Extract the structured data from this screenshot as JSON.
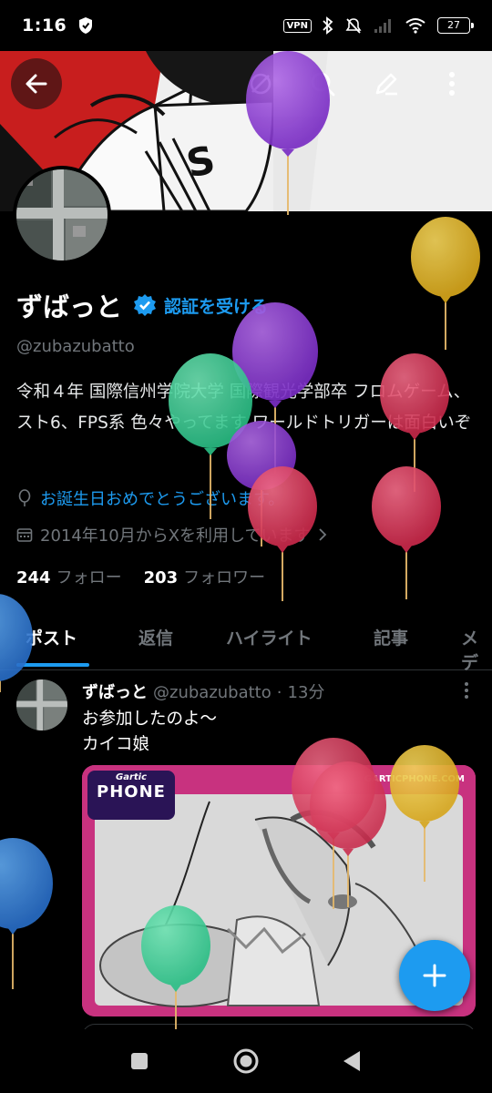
{
  "status_bar": {
    "time": "1:16",
    "vpn": "VPN",
    "battery": "27"
  },
  "header_actions": {
    "back_icon": "arrow-left-icon",
    "search_icon": "search-icon",
    "edit_icon": "pencil-icon",
    "more_icon": "more-vertical-icon"
  },
  "profile": {
    "display_name": "ずばっと",
    "verify_cta": "認証を受ける",
    "handle": "@zubazubatto",
    "bio": "令和４年 国際信州学院大学 国際観光学部卒 フロムゲーム、スト6、FPS系 色々やってます ワールドトリガーは面白いぞ",
    "birthday": "お誕生日おめでとうございます。",
    "joined": "2014年10月からXを利用しています",
    "following_count": "244",
    "following_label": "フォロー",
    "followers_count": "203",
    "followers_label": "フォロワー"
  },
  "tabs": [
    "ポスト",
    "返信",
    "ハイライト",
    "記事",
    "メデ"
  ],
  "post": {
    "author": "ずばっと",
    "handle": "@zubazubatto",
    "separator": "·",
    "time": "13分",
    "text": "お参加したのよ〜\nカイコ娘",
    "image_brand": "Gartic",
    "image_brand_sub": "PHONE",
    "image_url_text": "GARTICPHONE.COM"
  },
  "colors": {
    "accent": "#1d9bf0",
    "background": "#000000",
    "muted": "#71767b",
    "image_frame": "#c8327f"
  }
}
